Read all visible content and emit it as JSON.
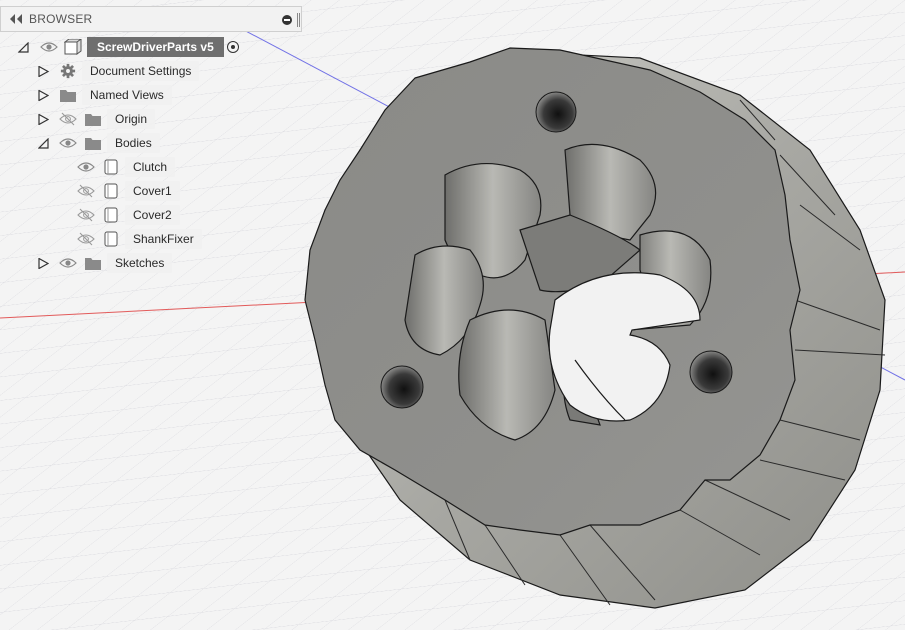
{
  "browser": {
    "title": "BROWSER",
    "root": {
      "label": "ScrewDriverParts v5",
      "expanded": true,
      "visible": true
    },
    "items": [
      {
        "label": "Document Settings",
        "icon": "gear-icon",
        "expanded": false,
        "visible": null
      },
      {
        "label": "Named Views",
        "icon": "folder-icon",
        "expanded": false,
        "visible": null
      },
      {
        "label": "Origin",
        "icon": "folder-icon",
        "expanded": false,
        "visible": false
      },
      {
        "label": "Bodies",
        "icon": "folder-icon",
        "expanded": true,
        "visible": true,
        "children": [
          {
            "label": "Clutch",
            "icon": "body-icon",
            "visible": true
          },
          {
            "label": "Cover1",
            "icon": "body-icon",
            "visible": false
          },
          {
            "label": "Cover2",
            "icon": "body-icon",
            "visible": false
          },
          {
            "label": "ShankFixer",
            "icon": "body-icon",
            "visible": false
          }
        ]
      },
      {
        "label": "Sketches",
        "icon": "folder-icon",
        "expanded": false,
        "visible": true
      }
    ]
  },
  "colors": {
    "background": "#f4f4f4",
    "grid": "#d8d8de",
    "x_axis": "#e05050",
    "z_axis": "#6a6ae0",
    "part_face": "#8c8c89",
    "part_side": "#b5b5b0",
    "selected_root": "#6f6f6f"
  }
}
